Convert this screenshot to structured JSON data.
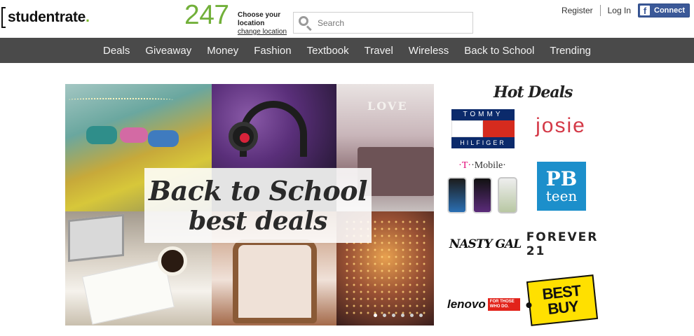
{
  "header": {
    "logo_part1": "student",
    "logo_part2": "rate",
    "logo_dot": ".",
    "counter": "247",
    "location_label": "Choose your location",
    "location_link": "change location",
    "search_placeholder": "Search",
    "register": "Register",
    "login": "Log In",
    "connect": "Connect",
    "fb_letter": "f"
  },
  "nav": {
    "items": [
      "Deals",
      "Giveaway",
      "Money",
      "Fashion",
      "Textbook",
      "Travel",
      "Wireless",
      "Back to School",
      "Trending"
    ]
  },
  "hero": {
    "title": "Back to School",
    "subtitle": "best deals",
    "tile3_text": "LOVE",
    "slides": 6,
    "active_slide": 1
  },
  "hot_deals": {
    "title": "Hot Deals",
    "brands": {
      "tommy_top": "TOMMY",
      "tommy_bottom": "HILFIGER",
      "josie": "josie",
      "tmobile_prefix": "·T·",
      "tmobile_word": "·Mobile·",
      "pbteen_pb": "PB",
      "pbteen_teen": "teen",
      "nastygal": "NASTY GAL",
      "forever21": "FOREVER 21",
      "lenovo": "lenovo",
      "lenovo_tag": "FOR THOSE WHO DO.",
      "bestbuy_top": "BEST",
      "bestbuy_bottom": "BUY"
    }
  },
  "colors": {
    "brand_green": "#72b03a",
    "nav_bg": "#4a4a4a",
    "facebook": "#3b5998"
  }
}
